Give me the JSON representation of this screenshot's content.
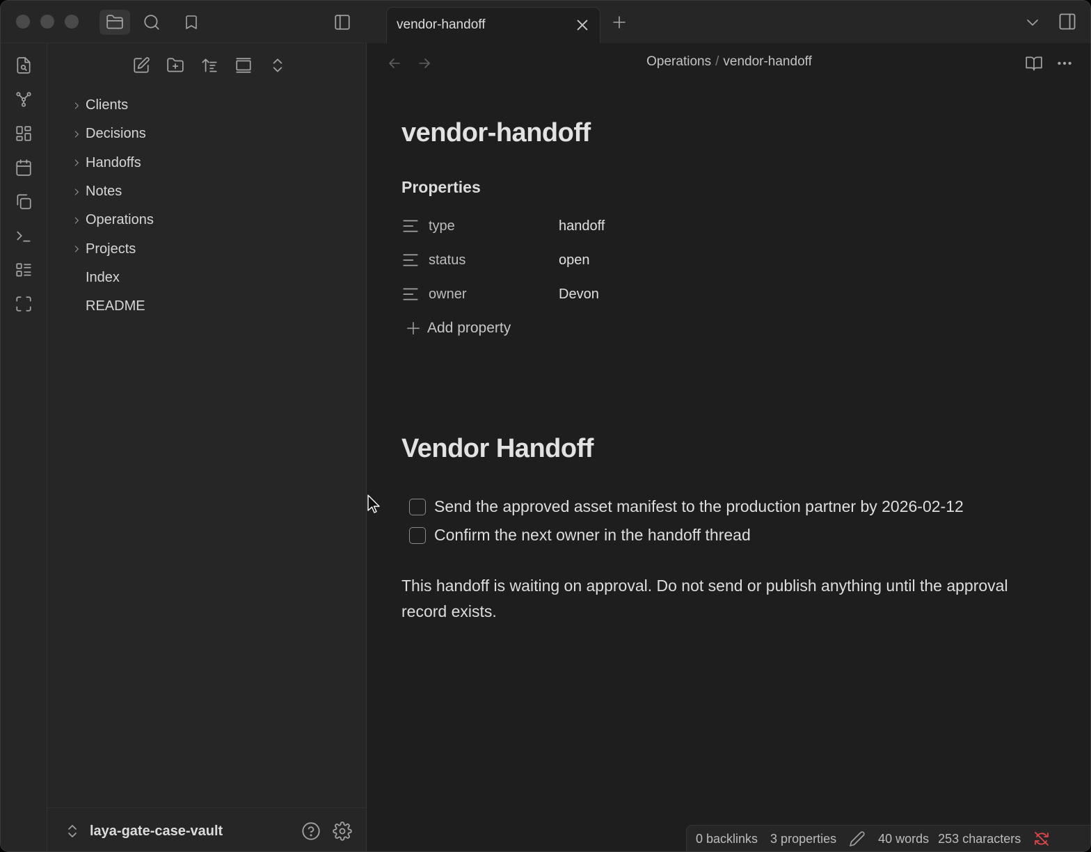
{
  "window": {
    "traffic_lights": [
      "close",
      "minimize",
      "zoom"
    ]
  },
  "sidebar_header": {
    "icons": [
      "folder-icon",
      "search-icon",
      "bookmark-icon"
    ],
    "toggle_icon": "sidebar-left-icon"
  },
  "ribbon": {
    "icons": [
      "file-search-icon",
      "graph-icon",
      "grid-icon",
      "calendar-icon",
      "copy-icon",
      "terminal-icon",
      "list-icon",
      "fullscreen-icon"
    ]
  },
  "file_nav_actions": [
    "new-note-icon",
    "new-folder-icon",
    "sort-icon",
    "view-icon",
    "collapse-icon"
  ],
  "file_tree": {
    "folders": [
      "Clients",
      "Decisions",
      "Handoffs",
      "Notes",
      "Operations",
      "Projects"
    ],
    "files": [
      "Index",
      "README"
    ]
  },
  "vault": {
    "name": "laya-gate-case-vault"
  },
  "tab": {
    "title": "vendor-handoff"
  },
  "breadcrumb": {
    "folder": "Operations",
    "separator": "/",
    "note": "vendor-handoff"
  },
  "note": {
    "title": "vendor-handoff",
    "properties_heading": "Properties",
    "properties": [
      {
        "key": "type",
        "value": "handoff"
      },
      {
        "key": "status",
        "value": "open"
      },
      {
        "key": "owner",
        "value": "Devon"
      }
    ],
    "add_property": "Add property",
    "heading": "Vendor Handoff",
    "tasks": [
      {
        "text": "Send the approved asset manifest to the production partner by 2026-02-12",
        "checked": false
      },
      {
        "text": "Confirm the next owner in the handoff thread",
        "checked": false
      }
    ],
    "paragraph": "This handoff is waiting on approval. Do not send or publish anything until the approval record exists."
  },
  "status_bar": {
    "backlinks": "0 backlinks",
    "properties": "3 properties",
    "words": "40 words",
    "characters": "253 characters",
    "sync_color": "#e0474c"
  }
}
